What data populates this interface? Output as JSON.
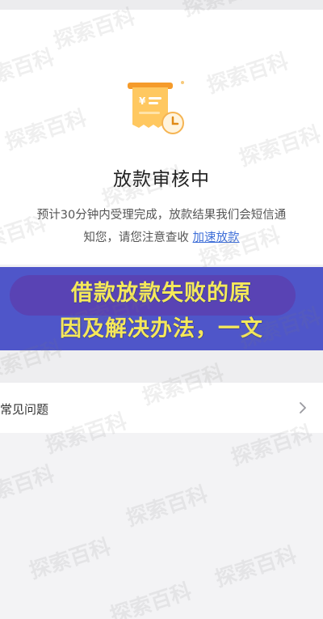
{
  "review_card": {
    "title": "放款审核中",
    "description_line1": "预计30分钟内受理完成，放款结果我们会短信通",
    "description_line2_prefix": "知您，请您注意查收 ",
    "speed_up_link": "加速放款"
  },
  "banner": {
    "line1": "借款放款失败的原",
    "line2": "因及解决办法，一文"
  },
  "faq": {
    "label": "常见问题"
  },
  "watermark": "探索百科",
  "colors": {
    "link": "#3f6fd8",
    "banner_bg": "#4f56c9",
    "banner_text": "#f5e85a",
    "receipt_orange": "#f5a623"
  },
  "icons": [
    "receipt-icon",
    "clock-icon",
    "chevron-right-icon"
  ]
}
